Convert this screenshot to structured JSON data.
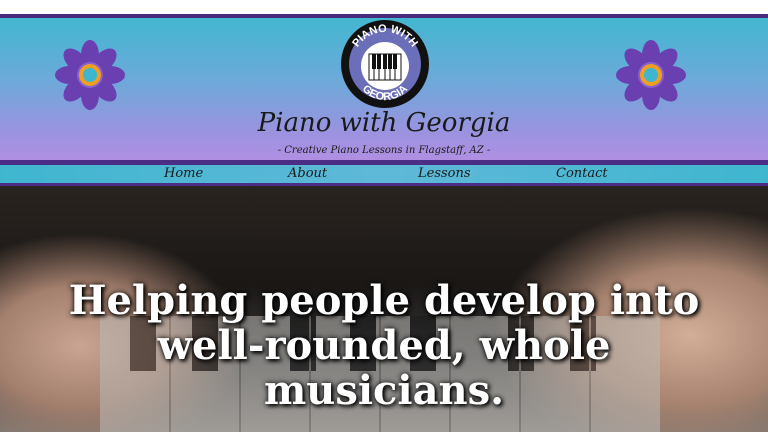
{
  "site": {
    "title": "Piano with Georgia",
    "tagline": "- Creative Piano Lessons in Flagstaff, AZ -",
    "logo_text_top": "PIANO WITH",
    "logo_text_bottom": "GEORGIA"
  },
  "nav": {
    "items": [
      {
        "label": "Home"
      },
      {
        "label": "About"
      },
      {
        "label": "Lessons"
      },
      {
        "label": "Contact"
      }
    ]
  },
  "hero": {
    "headline_line1": "Helping people develop into",
    "headline_line2": "well-rounded, whole",
    "headline_line3": "musicians."
  },
  "colors": {
    "header_top": "#42b7d0",
    "header_bottom": "#b08fe2",
    "nav_border": "#4b2d86",
    "flower_petal": "#6a3fb0",
    "flower_center": "#f0a020"
  }
}
